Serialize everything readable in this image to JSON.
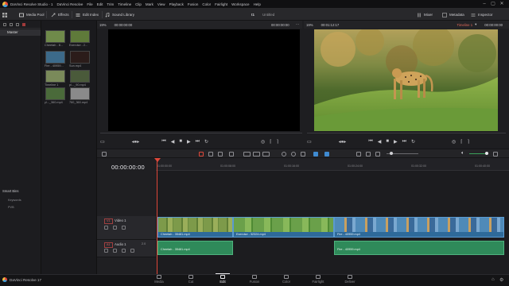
{
  "app": {
    "title": "DaVinci Resolve Studio - 1",
    "version_label": "DaVinci Resolve 17",
    "project_name": "Untitled",
    "project_index": "t1"
  },
  "menu": [
    "DaVinci Resolve",
    "File",
    "Edit",
    "Trim",
    "Timeline",
    "Clip",
    "Mark",
    "View",
    "Playback",
    "Fusion",
    "Color",
    "Fairlight",
    "Workspace",
    "Help"
  ],
  "toolbar": {
    "media_pool": "Media Pool",
    "effects": "Effects",
    "edit_index": "Edit Index",
    "sound_library": "Sound Library",
    "mixer": "Mixer",
    "metadata": "Metadata",
    "inspector": "Inspector"
  },
  "bins": {
    "master": "Master",
    "smart_bins": "Smart Bins",
    "keywords": "Keywords",
    "people": "PVB"
  },
  "media_pool": {
    "clips": [
      {
        "label": "Cheetah - 8...",
        "color": "#6f8a4a"
      },
      {
        "label": "Exercise - 2...",
        "color": "#5f7a3a"
      },
      {
        "label": "Fire - 40959...",
        "color": "#3c6a8a"
      },
      {
        "label": "Sun.mp4",
        "color": "#2b1c1a"
      },
      {
        "label": "Timeline 1",
        "color": "#7a8a5a"
      },
      {
        "label": "pl..._90.mp4",
        "color": "#4a5a3a"
      },
      {
        "label": "yl..._360.mp4",
        "color": "#4a6a3a"
      },
      {
        "label": "760_360.mp4",
        "color": "#8a8a8a"
      }
    ]
  },
  "source_viewer": {
    "zoom": "19%",
    "tc_left": "00:00:00:00",
    "tc_right": "00:00:00:00"
  },
  "timeline_viewer": {
    "zoom": "19%",
    "duration": "00:01:12:17",
    "timeline_name": "Timeline 1",
    "tc": "00:00:00:00"
  },
  "timeline": {
    "timecode": "00:00:00:00",
    "ruler": [
      "01:00:00:00",
      "01:00:08:00",
      "01:00:16:00",
      "01:00:24:00",
      "01:00:32:00",
      "01:00:40:00"
    ],
    "video_track": {
      "tag": "V1",
      "name": "Video 1"
    },
    "audio_track": {
      "tag": "A1",
      "name": "Audio 1",
      "level": "2.0"
    },
    "video_clips": [
      "Cheetah - 35481.mp4",
      "Exercise - 32324.mp4",
      "Fire - 40959.mp4"
    ],
    "audio_clips": [
      "Cheetah - 35481.mp4",
      "Fire - 40959.mp4"
    ]
  },
  "pages": [
    "Media",
    "Cut",
    "Edit",
    "Fusion",
    "Color",
    "Fairlight",
    "Deliver"
  ],
  "active_page": "Edit",
  "colors": {
    "accent_red": "#e0483a",
    "video_clip": "#2e6a9a",
    "audio_clip": "#2f8a5a"
  }
}
